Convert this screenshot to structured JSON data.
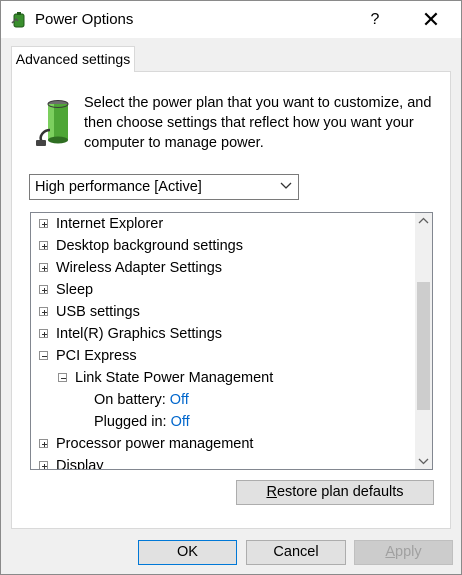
{
  "window": {
    "title": "Power Options",
    "help_label": "?",
    "close_label": "✕"
  },
  "tab": {
    "label": "Advanced settings"
  },
  "intro": {
    "text": "Select the power plan that you want to customize, and then choose settings that reflect how you want your computer to manage power."
  },
  "plan_select": {
    "value": "High performance [Active]"
  },
  "tree": {
    "items": [
      {
        "label": "Internet Explorer",
        "expander": "plus"
      },
      {
        "label": "Desktop background settings",
        "expander": "plus"
      },
      {
        "label": "Wireless Adapter Settings",
        "expander": "plus"
      },
      {
        "label": "Sleep",
        "expander": "plus"
      },
      {
        "label": "USB settings",
        "expander": "plus"
      },
      {
        "label": "Intel(R) Graphics Settings",
        "expander": "plus"
      },
      {
        "label": "PCI Express",
        "expander": "minus"
      },
      {
        "label": "Link State Power Management",
        "expander": "minus"
      },
      {
        "label": "On battery:",
        "value": "Off"
      },
      {
        "label": "Plugged in:",
        "value": "Off"
      },
      {
        "label": "Processor power management",
        "expander": "plus"
      },
      {
        "label": "Display",
        "expander": "plus"
      }
    ]
  },
  "buttons": {
    "restore_first": "R",
    "restore_rest": "estore plan defaults",
    "ok": "OK",
    "cancel": "Cancel",
    "apply_first": "A",
    "apply_rest": "pply"
  },
  "colors": {
    "link_value": "#0066cc",
    "ok_border": "#0078d7"
  }
}
